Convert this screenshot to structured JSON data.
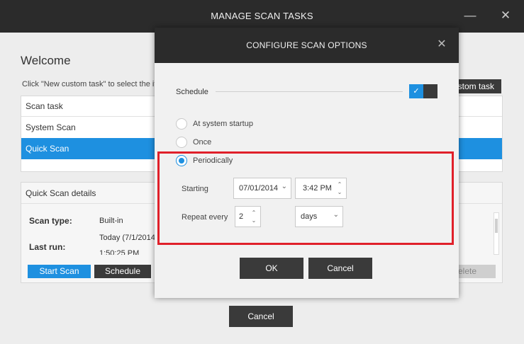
{
  "window": {
    "title": "MANAGE SCAN TASKS",
    "minimize_icon": "minimize-icon",
    "close_icon": "close-icon"
  },
  "main": {
    "heading": "Welcome",
    "hint": "Click \"New custom task\" to select the it",
    "new_task_label": "stom task",
    "task_list": {
      "header": "Scan task",
      "items": [
        {
          "label": "System Scan",
          "selected": false
        },
        {
          "label": "Quick Scan",
          "selected": true
        }
      ]
    },
    "details": {
      "header": "Quick Scan details",
      "scan_type_label": "Scan type:",
      "scan_type_value": "Built-in",
      "last_run_label": "Last run:",
      "last_run_value": "Today (7/1/2014",
      "last_run_time": "1:50:25 PM"
    },
    "buttons": {
      "start_scan": "Start Scan",
      "schedule": "Schedule",
      "delete": "elete",
      "cancel": "Cancel"
    }
  },
  "dialog": {
    "title": "CONFIGURE SCAN OPTIONS",
    "schedule_label": "Schedule",
    "schedule_enabled": true,
    "options": [
      {
        "label": "At system startup",
        "checked": false
      },
      {
        "label": "Once",
        "checked": false
      },
      {
        "label": "Periodically",
        "checked": true
      }
    ],
    "starting_label": "Starting",
    "start_date": "07/01/2014",
    "start_time": "3:42 PM",
    "repeat_label": "Repeat every",
    "repeat_value": "2",
    "repeat_unit": "days",
    "ok_label": "OK",
    "cancel_label": "Cancel"
  },
  "colors": {
    "accent": "#1e90e0",
    "titlebar": "#2b2b2b",
    "highlight": "#e0202a"
  }
}
